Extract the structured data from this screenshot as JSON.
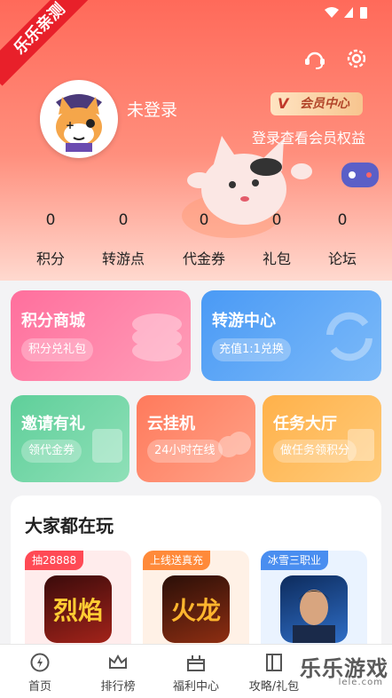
{
  "ribbon": "乐乐亲测",
  "profile": {
    "login_text": "未登录",
    "vip_badge": "会员中心",
    "vip_v": "V",
    "vip_link": "登录查看会员权益"
  },
  "stats": [
    {
      "value": "0",
      "label": "积分"
    },
    {
      "value": "0",
      "label": "转游点"
    },
    {
      "value": "0",
      "label": "代金券"
    },
    {
      "value": "0",
      "label": "礼包"
    },
    {
      "value": "0",
      "label": "论坛"
    }
  ],
  "cards": {
    "points_mall": {
      "title": "积分商城",
      "sub": "积分兑礼包"
    },
    "transfer": {
      "title": "转游中心",
      "sub": "充值1:1兑换"
    },
    "invite": {
      "title": "邀请有礼",
      "sub": "领代金券"
    },
    "cloud": {
      "title": "云挂机",
      "sub": "24小时在线"
    },
    "tasks": {
      "title": "任务大厅",
      "sub": "做任务领积分"
    }
  },
  "playing": {
    "title": "大家都在玩",
    "games": [
      {
        "tag": "抽28888",
        "tag_color": "#ff4a55",
        "icon_text": "烈焰"
      },
      {
        "tag": "上线送真充",
        "tag_color": "#ff8a3a",
        "icon_text": "火龙"
      },
      {
        "tag": "冰雪三职业",
        "tag_color": "#4a8ef0",
        "icon_text": ""
      }
    ]
  },
  "tabs": [
    {
      "label": "首页",
      "icon": "home-icon"
    },
    {
      "label": "排行榜",
      "icon": "crown-icon"
    },
    {
      "label": "福利中心",
      "icon": "gift-icon"
    },
    {
      "label": "攻略/礼包",
      "icon": "book-icon"
    }
  ],
  "watermark": {
    "main": "乐乐游戏",
    "sub": "lele.com"
  }
}
